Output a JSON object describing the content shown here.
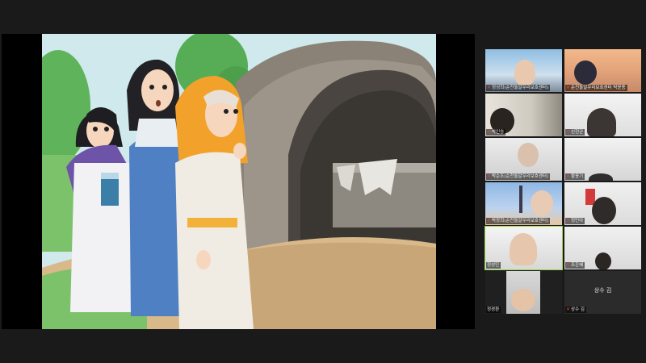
{
  "meeting": {
    "shared_content": "storybook-illustration"
  },
  "participants": [
    {
      "name": "정성희(순천돌알우리보호센터)",
      "muted": true
    },
    {
      "name": "순천돌알우리보호센터 박윤종",
      "muted": true
    },
    {
      "name": "박인승",
      "muted": true
    },
    {
      "name": "신현균",
      "muted": true
    },
    {
      "name": "박순조(순천돌알우리보호센터)",
      "muted": true
    },
    {
      "name": "황윤기",
      "muted": true
    },
    {
      "name": "박창희(순천돌알우리보호센터)",
      "muted": true
    },
    {
      "name": "정민아",
      "muted": true
    },
    {
      "name": "정성민",
      "muted": false
    },
    {
      "name": "조은혜",
      "muted": true
    },
    {
      "name": "정경환",
      "muted": false
    },
    {
      "name": "상수 김",
      "muted": true,
      "center_label": "상수 김"
    }
  ],
  "colors": {
    "active_speaker_border": "#9ad14b",
    "muted_icon": "#e5463a",
    "background": "#1a1a1a"
  }
}
